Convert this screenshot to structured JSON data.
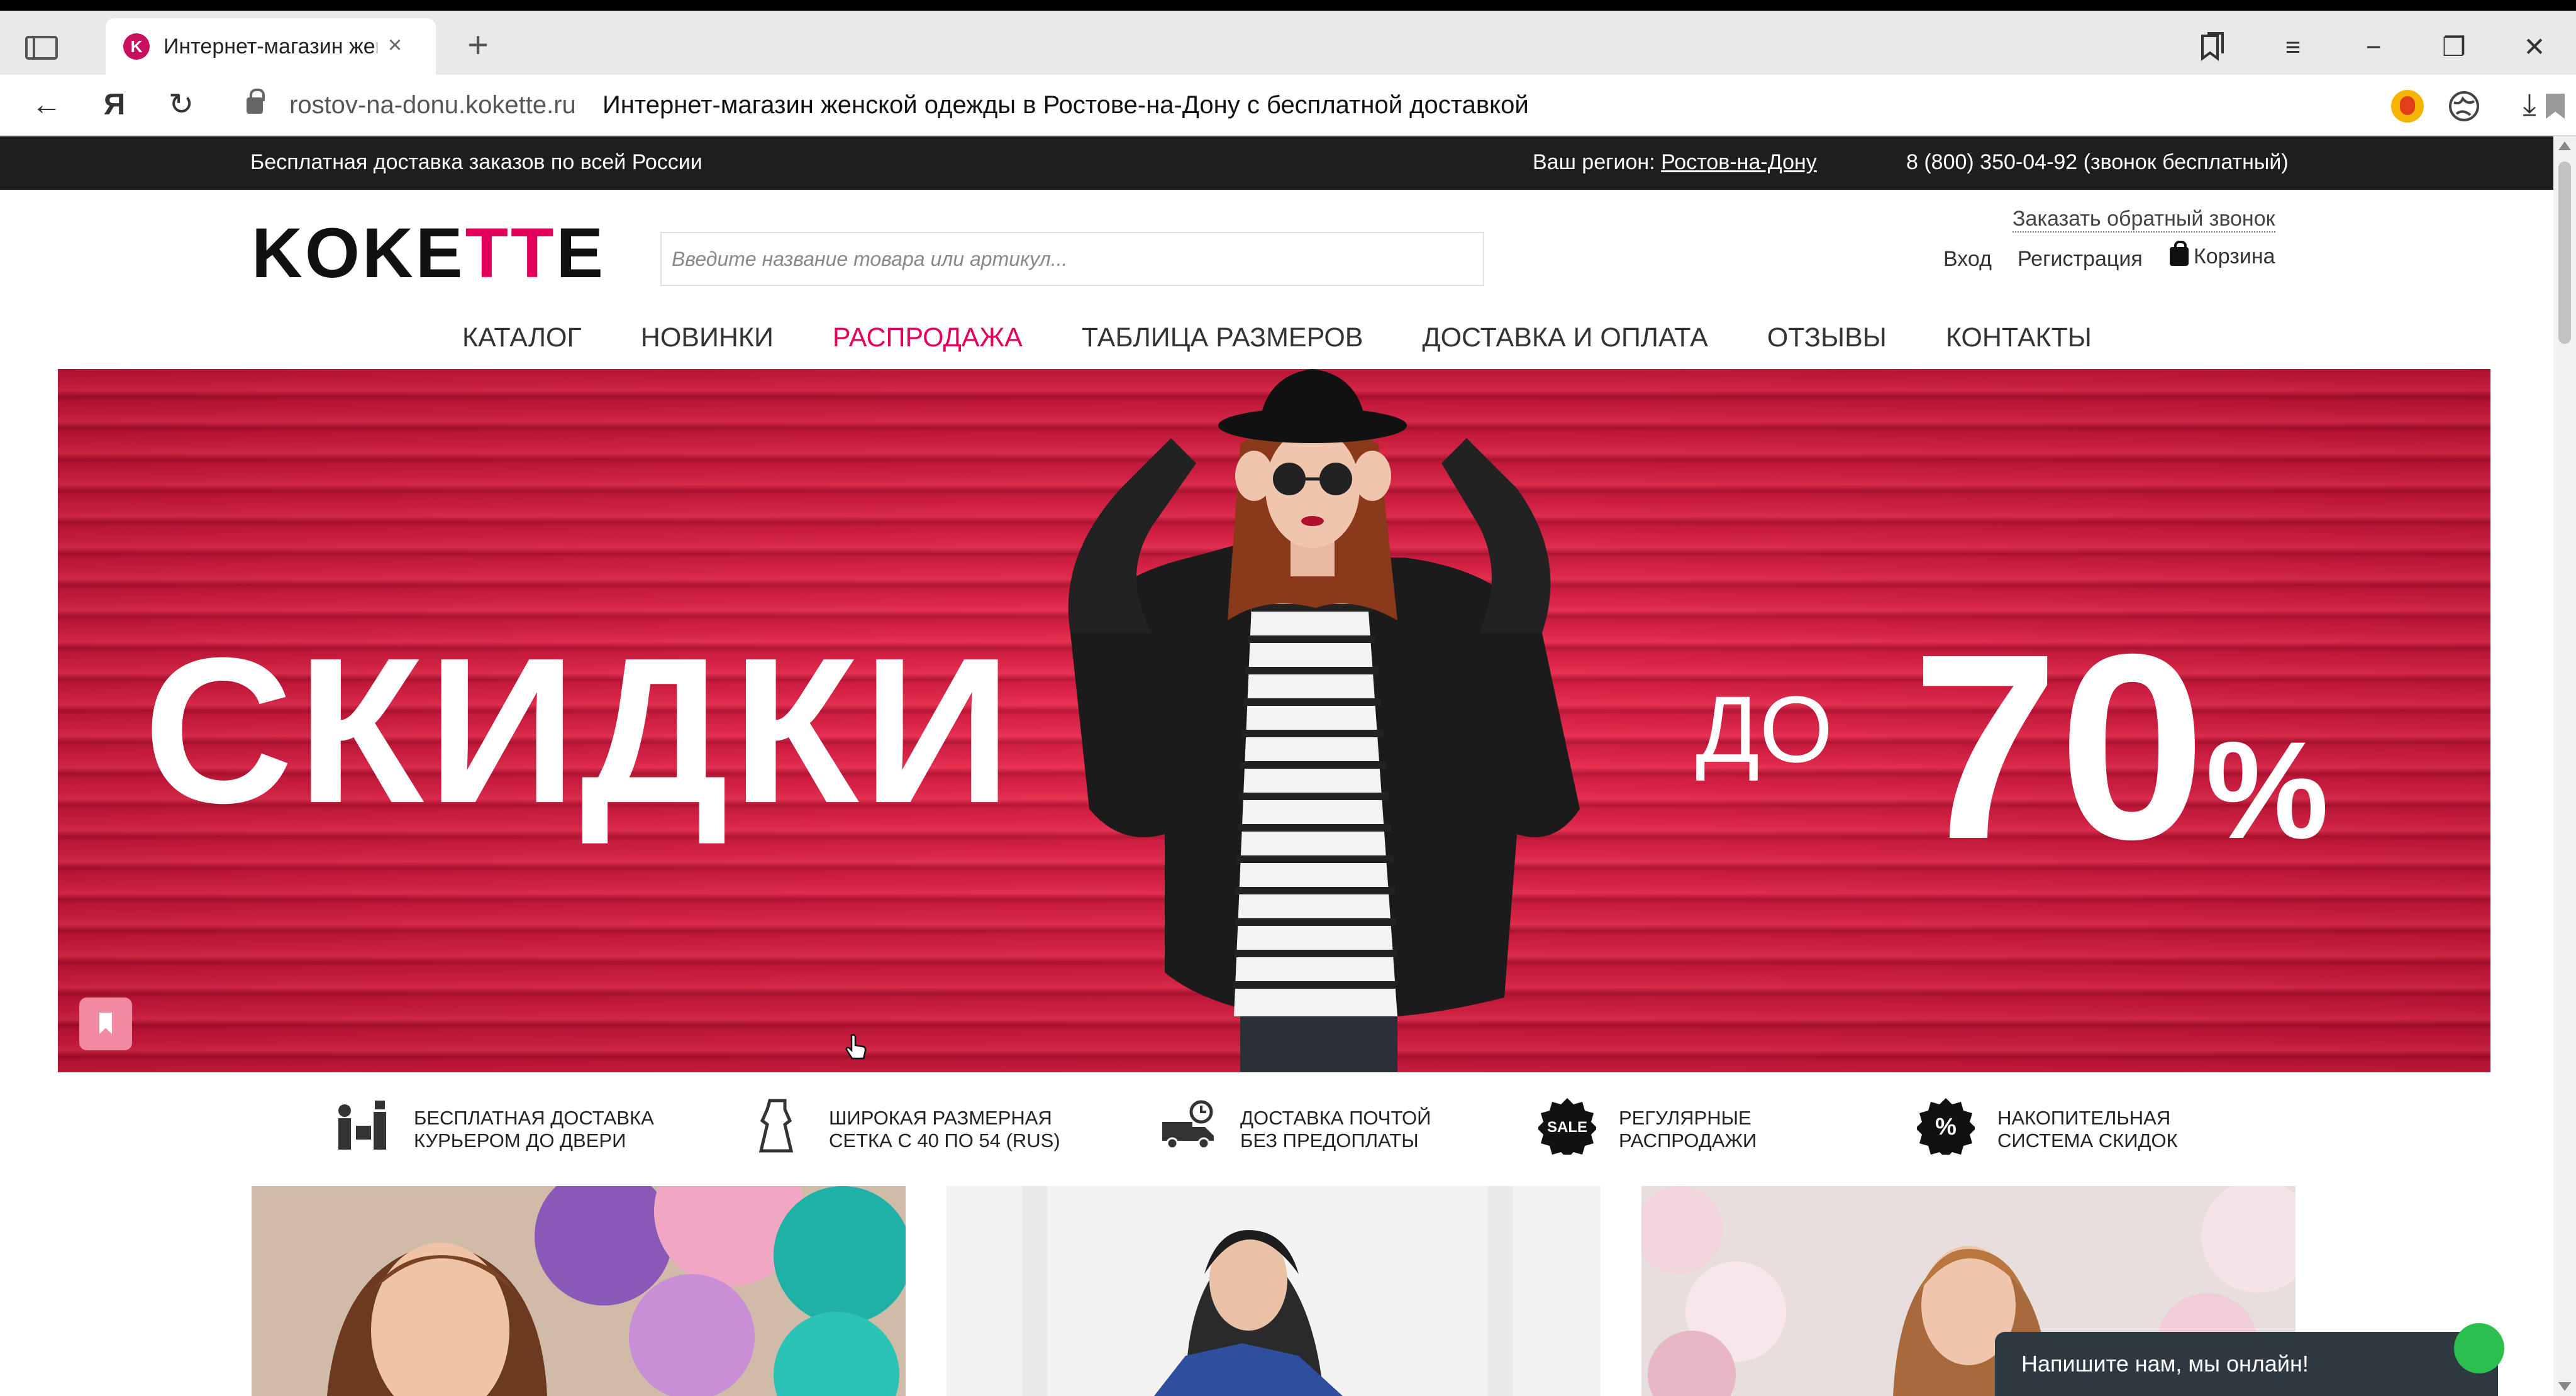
{
  "browser": {
    "tab_title": "Интернет-магазин жен",
    "tab_close": "×",
    "new_tab": "+",
    "url_domain": "rostov-na-donu.kokette.ru",
    "url_title": "Интернет-магазин женской одежды в Ростове-на-Дону с бесплатной доставкой",
    "controls": {
      "back": "←",
      "yandex": "Я",
      "reload": "↻",
      "menu": "≡",
      "minimize": "−",
      "restore": "❐",
      "close": "✕",
      "download": "⤓"
    }
  },
  "infobar": {
    "delivery": "Бесплатная доставка заказов по всей России",
    "region_label": "Ваш регион:",
    "region_value": "Ростов-на-Дону",
    "phone": "8 (800) 350-04-92 (звонок бесплатный)"
  },
  "header": {
    "logo_part1": "KOKE",
    "logo_part2": "TT",
    "logo_part3": "E",
    "search_placeholder": "Введите название товара или артикул...",
    "callback": "Заказать обратный звонок",
    "login": "Вход",
    "register": "Регистрация",
    "cart": "Корзина"
  },
  "nav": [
    {
      "label": "КАТАЛОГ"
    },
    {
      "label": "НОВИНКИ"
    },
    {
      "label": "РАСПРОДАЖА"
    },
    {
      "label": "ТАБЛИЦА РАЗМЕРОВ"
    },
    {
      "label": "ДОСТАВКА И ОПЛАТА"
    },
    {
      "label": "ОТЗЫВЫ"
    },
    {
      "label": "КОНТАКТЫ"
    }
  ],
  "banner": {
    "headline": "СКИДКИ",
    "prefix": "ДО",
    "value": "70",
    "unit": "%"
  },
  "features": [
    {
      "line1": "Бесплатная доставка",
      "line2": "курьером до двери"
    },
    {
      "line1": "Широкая размерная",
      "line2": "сетка с 40 по 54 (RUS)"
    },
    {
      "line1": "Доставка почтой",
      "line2": "без предоплаты"
    },
    {
      "line1": "Регулярные",
      "line2": "распродажи",
      "icon_text": "SALE"
    },
    {
      "line1": "Накопительная",
      "line2": "система скидок",
      "icon_text": "%"
    }
  ],
  "chat": {
    "label": "Напишите нам, мы онлайн!"
  },
  "colors": {
    "accent": "#e2005a",
    "banner_red": "#e62045",
    "infobar_bg": "#1e1e1e",
    "chat_bg": "#2f3942",
    "online": "#2dbf4d"
  }
}
